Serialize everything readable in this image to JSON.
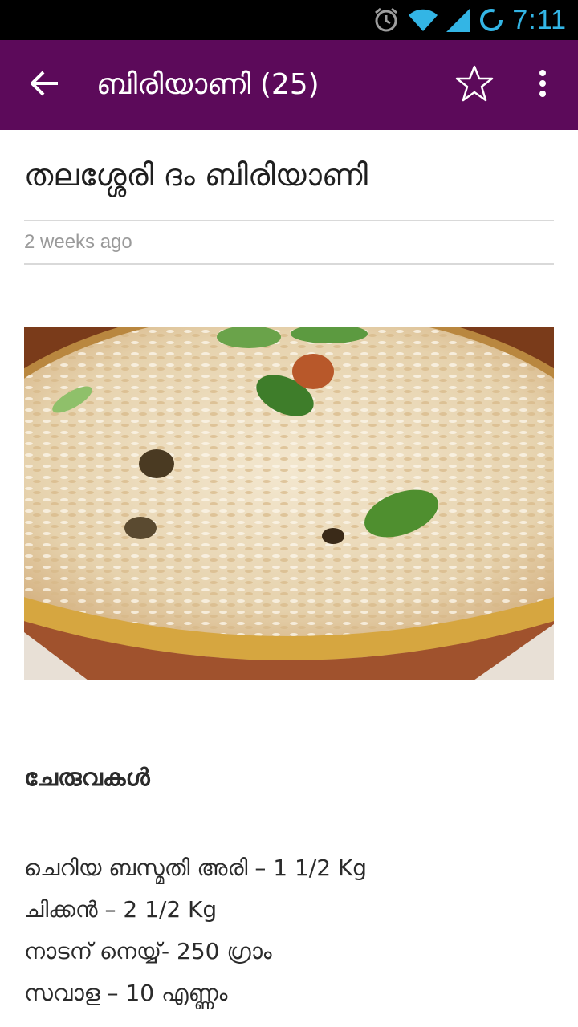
{
  "status_bar": {
    "time": "7:11",
    "icons": [
      "alarm-icon",
      "wifi-icon",
      "signal-icon",
      "sync-icon"
    ]
  },
  "app_bar": {
    "title": "ബിരിയാണി (25)",
    "back_icon": "arrow-left-icon",
    "favorite_icon": "star-outline-icon",
    "overflow_icon": "more-vertical-icon",
    "background": "#5c0a5a"
  },
  "article": {
    "title": "തലശ്ശേരി ദം ബിരിയാണി",
    "posted": "2 weeks ago",
    "section_heading": "ചേരുവകൾ",
    "ingredients": [
      "ചെറിയ ബസ്മതി അരി – 1 1/2 Kg",
      "ചിക്കൻ – 2 1/2 Kg",
      "നാടന് നെയ്യ്- 250 ഗ്രാം",
      "സവാള – 10 എണ്ണം"
    ]
  },
  "colors": {
    "accent": "#33b5e5",
    "text": "#2b2b2b",
    "muted": "#9a9a9a"
  }
}
